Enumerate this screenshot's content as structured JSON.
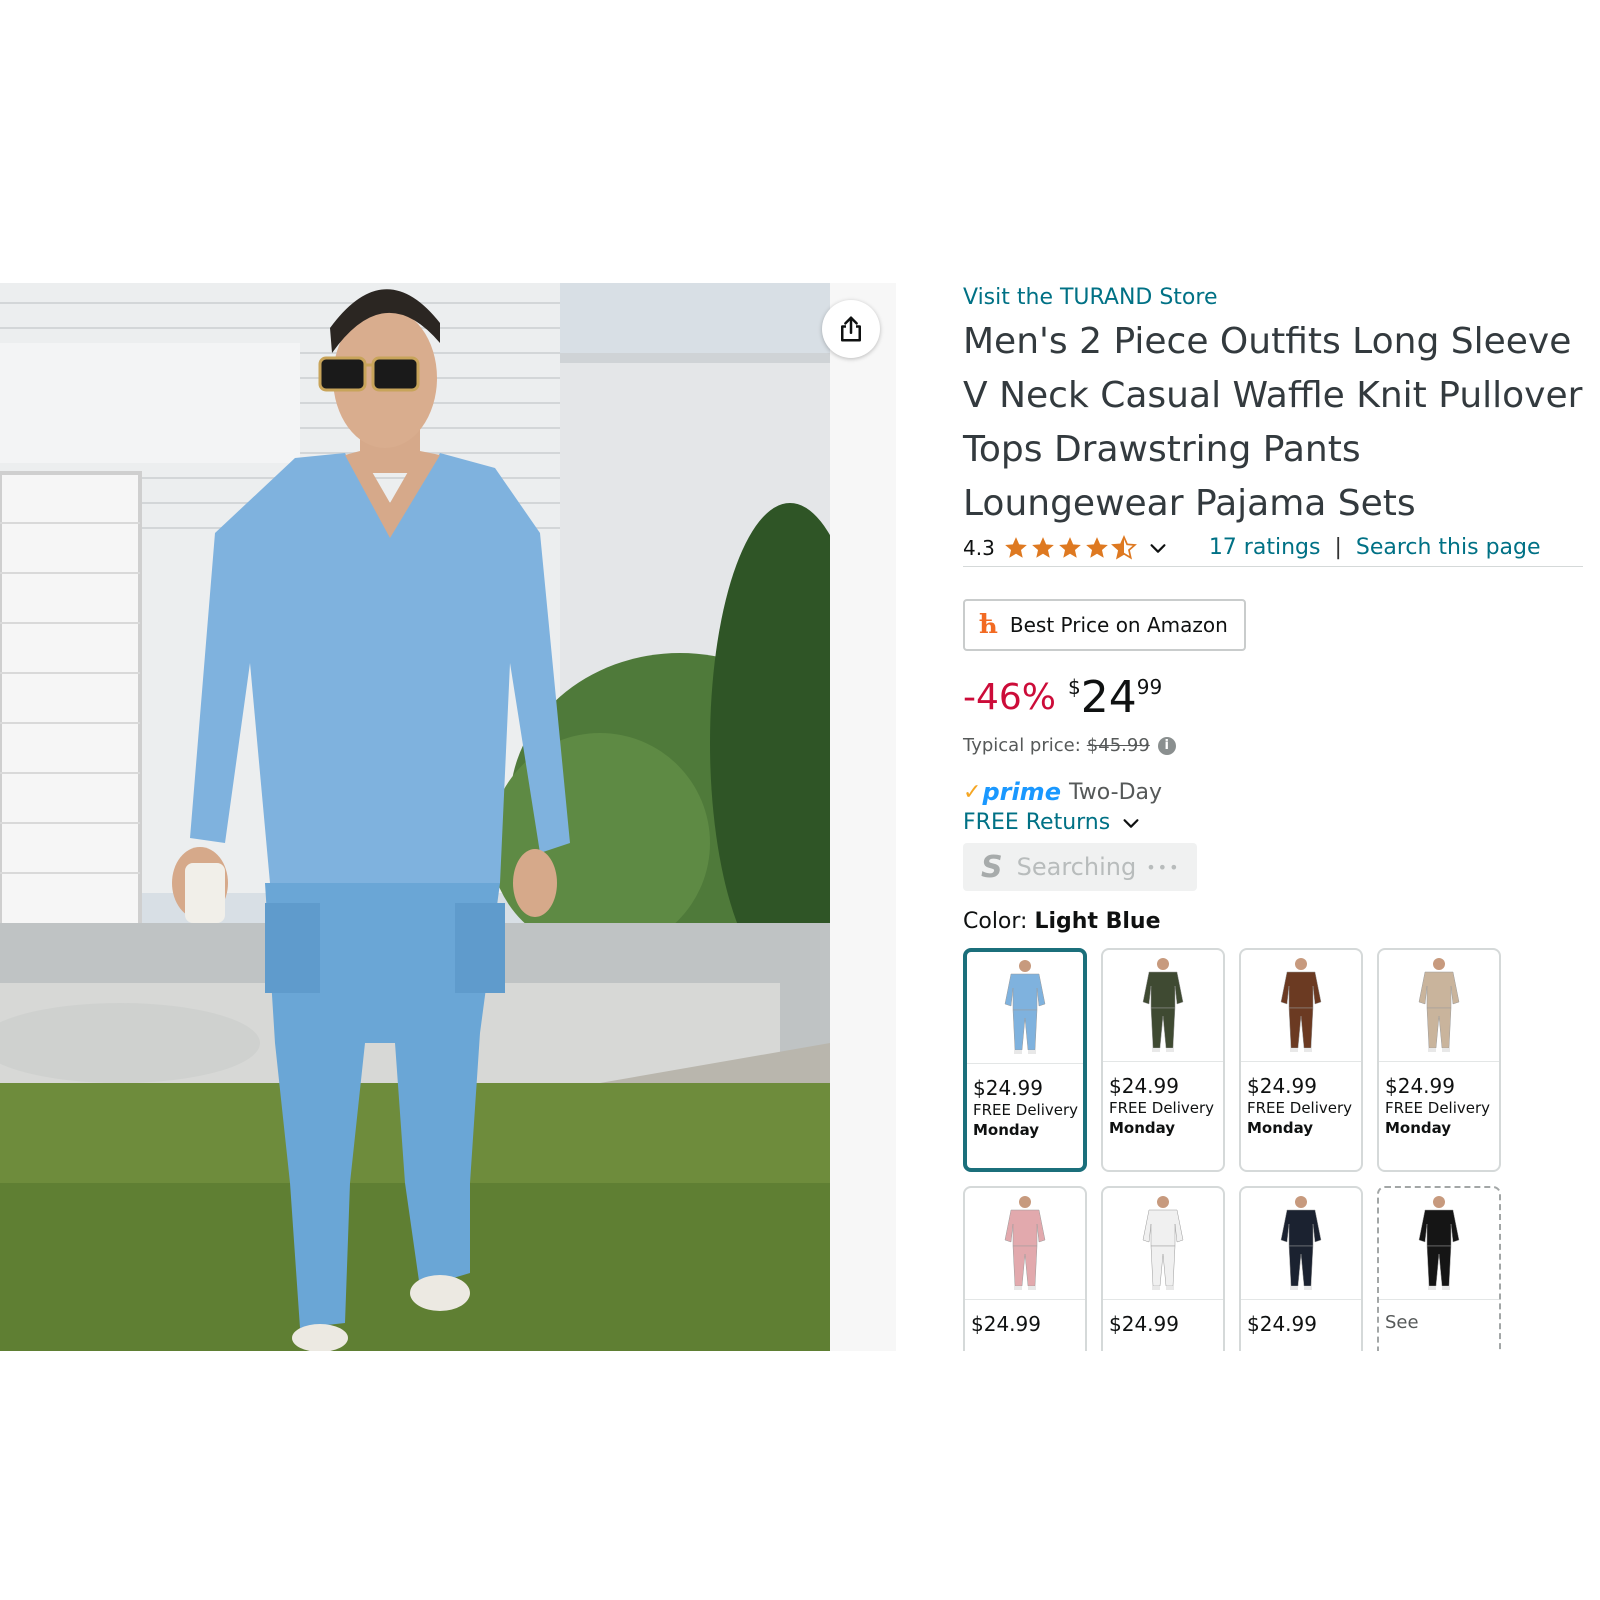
{
  "product": {
    "store_link": "Visit the TURAND Store",
    "title": "Men's 2 Piece Outfits Long Sleeve V Neck Casual Waffle Knit Pullover Tops Drawstring Pants Loungewear Pajama Sets",
    "rating": "4.3",
    "rating_stars": 4.3,
    "ratings_count": "17 ratings",
    "separator": "|",
    "search_link": "Search this page",
    "share_icon": "share-icon",
    "image_alt": "man-in-light-blue-waffle-knit-set"
  },
  "best_price": {
    "label": "Best Price on Amazon",
    "logo": "ћ"
  },
  "price": {
    "discount": "-46%",
    "currency": "$",
    "whole": "24",
    "fraction": "99",
    "typical_label": "Typical price:",
    "typical_value": "$45.99",
    "info_icon": "i"
  },
  "delivery": {
    "prime_check": "✓",
    "prime_word": "prime",
    "prime_speed": "Two-Day",
    "returns": "FREE Returns"
  },
  "searching": {
    "logo": "S",
    "label": "Searching",
    "dots": "•••"
  },
  "color": {
    "label": "Color:",
    "value": "Light Blue"
  },
  "swatches": [
    {
      "price": "$24.99",
      "delivery": "FREE Delivery",
      "day": "Monday",
      "color": "#7fb2de"
    },
    {
      "price": "$24.99",
      "delivery": "FREE Delivery",
      "day": "Monday",
      "color": "#3f4a32"
    },
    {
      "price": "$24.99",
      "delivery": "FREE Delivery",
      "day": "Monday",
      "color": "#6b3a22"
    },
    {
      "price": "$24.99",
      "delivery": "FREE Delivery",
      "day": "Monday",
      "color": "#c9b49c"
    },
    {
      "price": "$24.99",
      "color": "#e2a9ad"
    },
    {
      "price": "$24.99",
      "color": "#f0f0f0"
    },
    {
      "price": "$24.99",
      "color": "#1b2230"
    },
    {
      "see": "See",
      "color": "#151515"
    }
  ],
  "colors": {
    "link": "#007185",
    "discount": "#cc0c39",
    "prime": "#1a98ff",
    "selected_border": "#1b6f7b"
  }
}
